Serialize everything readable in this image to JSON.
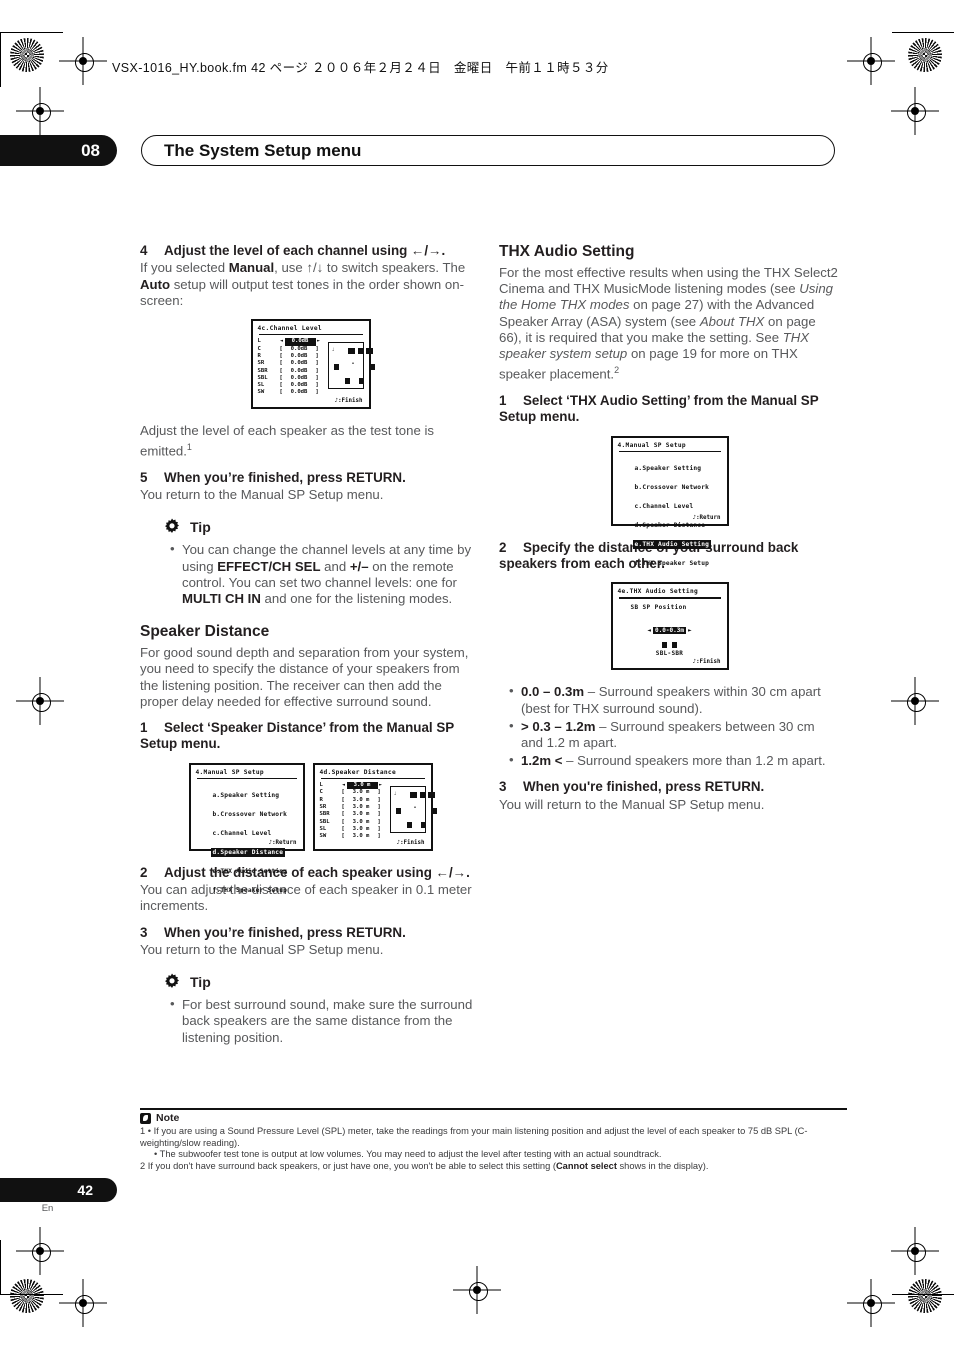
{
  "file_header": "VSX-1016_HY.book.fm  42 ページ  ２００６年２月２４日　金曜日　午前１１時５３分",
  "chapter": {
    "number": "08",
    "title": "The System Setup menu"
  },
  "page_footer": {
    "number": "42",
    "lang": "En"
  },
  "left_column": {
    "step4": {
      "heading_num": "4",
      "heading": "Adjust the level of each channel using ←/→.",
      "body_1": "If you selected ",
      "body_b1": "Manual",
      "body_2": ", use ↑/↓ to switch speakers. The ",
      "body_b2": "Auto",
      "body_3": " setup will output test tones in the order shown on-screen:"
    },
    "after_osd": "Adjust the level of each speaker as the test tone is emitted.",
    "after_osd_sup": "1",
    "step5": {
      "heading_num": "5",
      "heading": "When you’re finished, press RETURN.",
      "body": "You return to the Manual SP Setup menu."
    },
    "tip1": {
      "label": "Tip",
      "b1_1": "You can change the channel levels at any time by using ",
      "b1_b1": "EFFECT/CH SEL",
      "b1_2": " and ",
      "b1_b2": "+/–",
      "b1_3": " on the remote control. You can set two channel levels: one for ",
      "b1_b3": "MULTI CH IN",
      "b1_4": " and one for the listening modes."
    },
    "speaker_distance": {
      "heading": "Speaker Distance",
      "body": "For good sound depth and separation from your system, you need to specify the distance of your speakers from the listening position. The receiver can then add the proper delay needed for effective surround sound.",
      "step1_num": "1",
      "step1": "Select ‘Speaker Distance’ from the Manual SP Setup menu.",
      "step2_num": "2",
      "step2": "Adjust the distance of each speaker using ←/→.",
      "step2_body": "You can adjust the distance of each speaker in 0.1 meter increments.",
      "step3_num": "3",
      "step3": "When you’re finished, press RETURN.",
      "step3_body": "You return to the Manual SP Setup menu."
    },
    "tip2": {
      "label": "Tip",
      "b1": "For best surround sound, make sure the surround back speakers are the same distance from the listening position."
    }
  },
  "right_column": {
    "heading": "THX Audio Setting",
    "intro_1": "For the most effective results when using the THX Select2 Cinema and THX MusicMode listening modes (see ",
    "intro_i1": "Using the Home THX modes",
    "intro_2": " on page 27) with the Advanced Speaker Array (ASA) system (see ",
    "intro_i2": "About THX",
    "intro_3": " on page 66), it is required that you make the setting. See ",
    "intro_i3": "THX speaker system setup",
    "intro_4": " on page 19 for more on THX speaker placement.",
    "intro_sup": "2",
    "step1_num": "1",
    "step1": "Select ‘THX Audio Setting’ from the Manual SP Setup menu.",
    "step2_num": "2",
    "step2": "Specify the distance of your surround back speakers from each other.",
    "bullets": [
      {
        "bold": "0.0 – 0.3m",
        "text": " – Surround speakers within 30 cm apart (best for THX surround sound)."
      },
      {
        "bold": "> 0.3 – 1.2m",
        "text": " – Surround speakers between 30 cm and 1.2 m apart."
      },
      {
        "bold": "1.2m <",
        "text": " – Surround speakers more than 1.2 m apart."
      }
    ],
    "step3_num": "3",
    "step3": "When you're finished, press RETURN.",
    "step3_body": "You will return to the Manual SP Setup menu."
  },
  "osd_screens": {
    "channel_level": {
      "title": "4c.Channel Level",
      "finish": "♪:Finish",
      "rows": [
        {
          "ch": "L",
          "val": "0.0dB",
          "selected": true
        },
        {
          "ch": "C",
          "val": "0.0dB",
          "selected": false
        },
        {
          "ch": "R",
          "val": "0.0dB",
          "selected": false
        },
        {
          "ch": "SR",
          "val": "0.0dB",
          "selected": false
        },
        {
          "ch": "SBR",
          "val": "0.0dB",
          "selected": false
        },
        {
          "ch": "SBL",
          "val": "0.0dB",
          "selected": false
        },
        {
          "ch": "SL",
          "val": "0.0dB",
          "selected": false
        },
        {
          "ch": "SW",
          "val": "0.0dB",
          "selected": false
        }
      ]
    },
    "manual_sp_setup_distance": {
      "title": "4.Manual SP Setup",
      "return": "♪:Return",
      "items": [
        {
          "label": "a.Speaker Setting",
          "selected": false
        },
        {
          "label": "b.Crossover Network",
          "selected": false
        },
        {
          "label": "c.Channel Level",
          "selected": false
        },
        {
          "label": "d.Speaker Distance",
          "selected": true
        },
        {
          "label": "e.THX Audio Setting",
          "selected": false
        },
        {
          "label": "f.THX Speaker Setup",
          "selected": false
        }
      ]
    },
    "speaker_distance": {
      "title": "4d.Speaker Distance",
      "finish": "♪:Finish",
      "rows": [
        {
          "ch": "L",
          "val": "3.0 m",
          "selected": true
        },
        {
          "ch": "C",
          "val": "3.0 m",
          "selected": false
        },
        {
          "ch": "R",
          "val": "3.0 m",
          "selected": false
        },
        {
          "ch": "SR",
          "val": "3.0 m",
          "selected": false
        },
        {
          "ch": "SBR",
          "val": "3.0 m",
          "selected": false
        },
        {
          "ch": "SBL",
          "val": "3.0 m",
          "selected": false
        },
        {
          "ch": "SL",
          "val": "3.0 m",
          "selected": false
        },
        {
          "ch": "SW",
          "val": "3.0 m",
          "selected": false
        }
      ]
    },
    "manual_sp_setup_thx": {
      "title": "4.Manual SP Setup",
      "return": "♪:Return",
      "items": [
        {
          "label": "a.Speaker Setting",
          "selected": false
        },
        {
          "label": "b.Crossover Network",
          "selected": false
        },
        {
          "label": "c.Channel Level",
          "selected": false
        },
        {
          "label": "d.Speaker Distance",
          "selected": false
        },
        {
          "label": "e.THX Audio Setting",
          "selected": true
        },
        {
          "label": "f.THX Speaker Setup",
          "selected": false
        }
      ]
    },
    "thx_audio_setting": {
      "title": "4e.THX Audio Setting",
      "finish": "♪:Finish",
      "field_label": "SB SP Position",
      "value": "0.0-0.3m",
      "speaker_pair_label": "SBL-SBR"
    }
  },
  "note": {
    "label": "Note",
    "items": [
      "1 • If you are using a Sound Pressure Level (SPL) meter, take the readings from your main listening position and adjust the level of each speaker to 75 dB SPL (C-weighting/slow reading).",
      "• The subwoofer test tone is output at low volumes. You may need to adjust the level after testing with an actual soundtrack."
    ],
    "item2_pre": "2 If you don't have surround back speakers, or just have one, you won't be able to select this setting (",
    "item2_bold": "Cannot select",
    "item2_post": " shows in the display)."
  }
}
